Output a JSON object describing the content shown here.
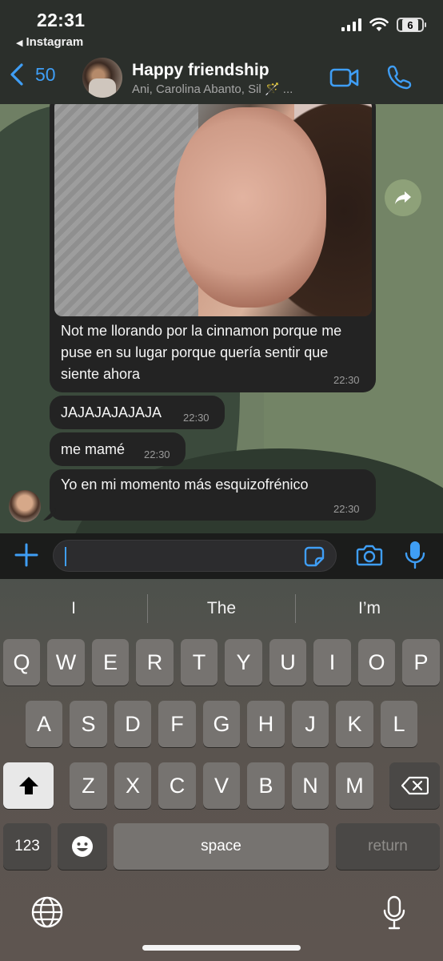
{
  "status_bar": {
    "time": "22:31",
    "back_app": "Instagram",
    "battery": "6"
  },
  "header": {
    "back_count": "50",
    "group_name": "Happy friendship",
    "members": "Ani, Carolina Abanto, Sil",
    "members_suffix": "🪄 ..."
  },
  "messages": [
    {
      "text": "Not me llorando por la cinnamon porque me puse en su lugar porque quería sentir que siente ahora",
      "time": "22:30",
      "has_photo": true
    },
    {
      "text": "JAJAJAJAJAJA",
      "time": "22:30"
    },
    {
      "text": "me mamé",
      "time": "22:30"
    },
    {
      "text": "Yo en mi momento más esquizofrénico",
      "time": "22:30"
    }
  ],
  "keyboard": {
    "suggestions": [
      "I",
      "The",
      "I’m"
    ],
    "row1": [
      "Q",
      "W",
      "E",
      "R",
      "T",
      "Y",
      "U",
      "I",
      "O",
      "P"
    ],
    "row2": [
      "A",
      "S",
      "D",
      "F",
      "G",
      "H",
      "J",
      "K",
      "L"
    ],
    "row3": [
      "Z",
      "X",
      "C",
      "V",
      "B",
      "N",
      "M"
    ],
    "numbers_label": "123",
    "space_label": "space",
    "return_label": "return"
  },
  "colors": {
    "accent": "#3f9ef5",
    "bubble": "#232323",
    "wallpaper": "#6f7f64"
  },
  "icons": [
    "back-chevron-icon",
    "video-call-icon",
    "phone-icon",
    "forward-icon",
    "plus-icon",
    "sticker-icon",
    "camera-icon",
    "microphone-icon",
    "shift-icon",
    "backspace-icon",
    "emoji-icon",
    "globe-icon"
  ]
}
